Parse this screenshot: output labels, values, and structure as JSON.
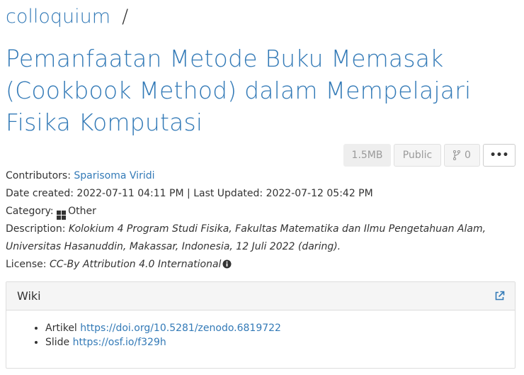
{
  "breadcrumb": {
    "project": "colloquium",
    "separator": "/"
  },
  "title": "Pemanfaatan Metode Buku Memasak (Cookbook Method) dalam Mempelajari Fisika Komputasi",
  "toolbar": {
    "size": "1.5MB",
    "visibility": "Public",
    "fork_count": "0",
    "more": "•••"
  },
  "meta": {
    "contributors_label": "Contributors:",
    "contributor": "Sparisoma Viridi",
    "date_created_label": "Date created:",
    "date_created": "2022-07-11 04:11 PM",
    "divider": "|",
    "last_updated_label": "Last Updated:",
    "last_updated": "2022-07-12 05:42 PM",
    "category_label": "Category:",
    "category": "Other",
    "description_label": "Description:",
    "description": "Kolokium 4 Program Studi Fisika, Fakultas Matematika dan Ilmu Pengetahuan Alam, Universitas Hasanuddin, Makassar, Indonesia, 12 Juli 2022 (daring).",
    "license_label": "License:",
    "license": "CC-By Attribution 4.0 International"
  },
  "wiki": {
    "heading": "Wiki",
    "items": [
      {
        "label": "Artikel",
        "link": "https://doi.org/10.5281/zenodo.6819722"
      },
      {
        "label": "Slide",
        "link": "https://osf.io/f329h"
      }
    ]
  },
  "colors": {
    "link": "#337ab7",
    "text": "#333333",
    "panel_bg": "#f5f5f5"
  },
  "icons": [
    "fork-icon",
    "grid-icon",
    "info-icon",
    "external-link-icon"
  ]
}
